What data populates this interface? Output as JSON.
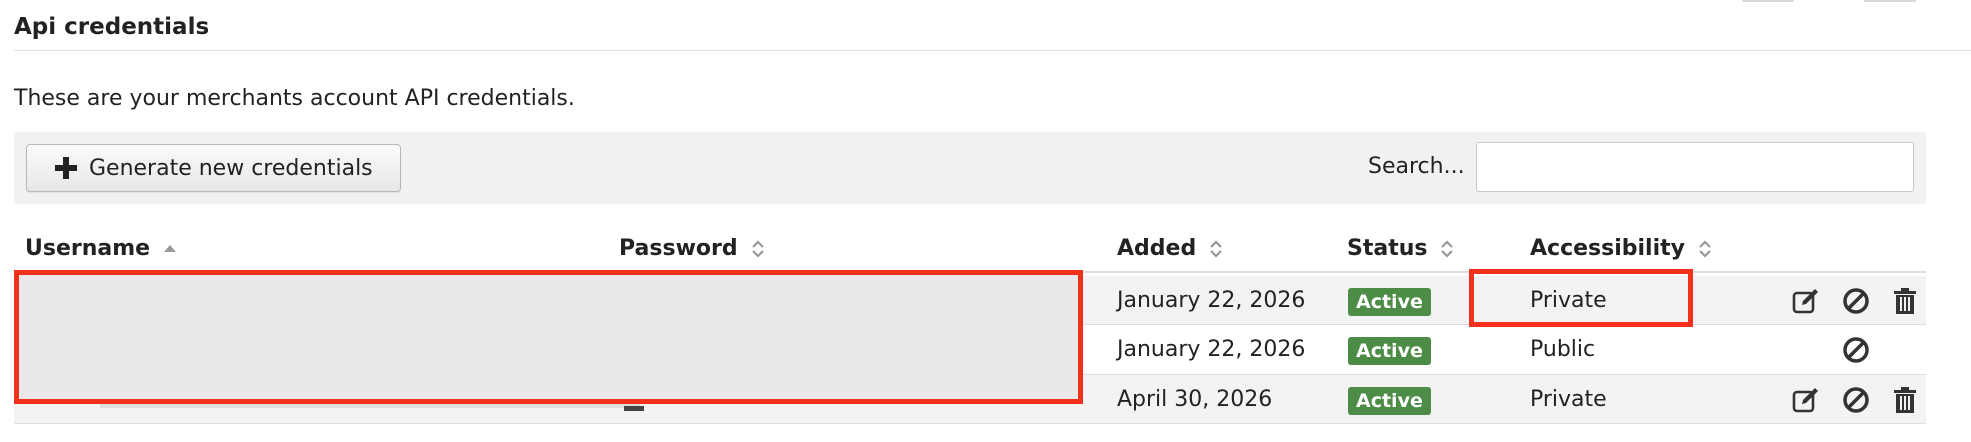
{
  "section": {
    "title": "Api credentials",
    "intro": "These are your merchants account API credentials."
  },
  "toolbar": {
    "generate_label": "Generate new credentials",
    "search_label": "Search...",
    "search_value": "",
    "search_placeholder": ""
  },
  "table": {
    "columns": [
      "Username",
      "Password",
      "Added",
      "Status",
      "Accessibility"
    ],
    "sort": {
      "column": "Username",
      "direction": "ascending"
    },
    "rows": [
      {
        "username": "",
        "password": "",
        "added": "January 22, 2026",
        "status": "Active",
        "accessibility": "Private",
        "actions": [
          "edit",
          "disable",
          "delete"
        ]
      },
      {
        "username": "",
        "password": "",
        "added": "January 22, 2026",
        "status": "Active",
        "accessibility": "Public",
        "actions": [
          "disable"
        ]
      },
      {
        "username": "",
        "password": "",
        "added": "April 30, 2026",
        "status": "Active",
        "accessibility": "Private",
        "actions": [
          "edit",
          "disable",
          "delete"
        ]
      }
    ]
  },
  "colors": {
    "active_badge": "#4c8c47",
    "highlight_border": "#f2301b",
    "toolbar_bg": "#f1f1f1",
    "row_shade": "#f3f3f3"
  },
  "icons": {
    "generate": "plus-icon",
    "sort_asc": "sort-ascending-icon",
    "sortable": "sort-both-icon",
    "edit": "edit-icon",
    "disable": "disable-icon",
    "delete": "trash-icon"
  }
}
